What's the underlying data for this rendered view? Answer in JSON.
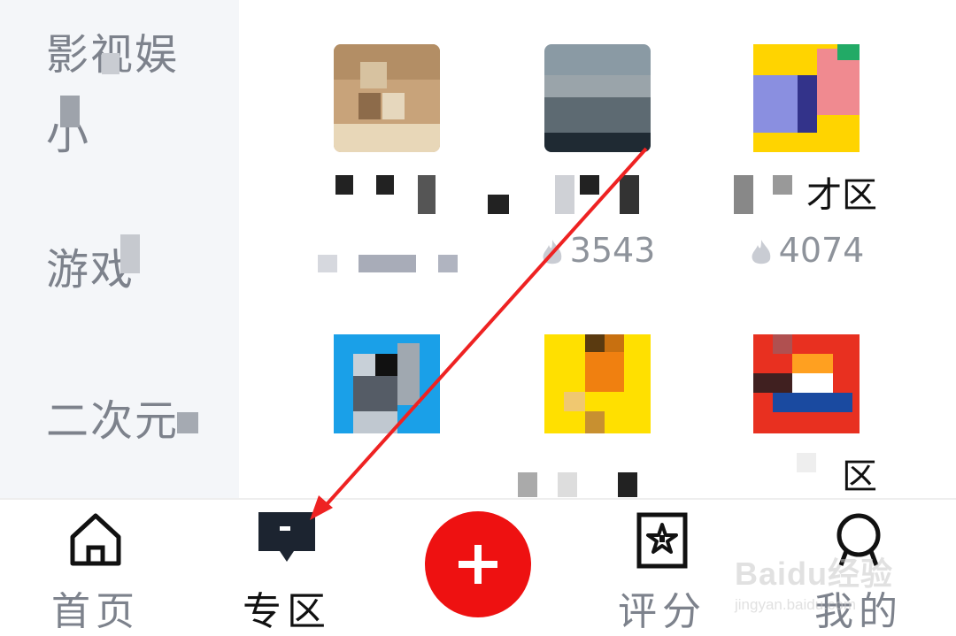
{
  "sidebar": {
    "items": [
      {
        "label": "影视娱"
      },
      {
        "label": "小"
      },
      {
        "label": "游戏"
      },
      {
        "label": "二次元"
      }
    ]
  },
  "zones": [
    {
      "name": "",
      "count": ""
    },
    {
      "name": "",
      "count": "3543"
    },
    {
      "name": "才区",
      "count": "4074"
    },
    {
      "name": "",
      "count": ""
    },
    {
      "name": "",
      "count": ""
    },
    {
      "name": "区",
      "count": ""
    }
  ],
  "tabbar": {
    "home": "首页",
    "zone": "专区",
    "rate": "评分",
    "mine": "我的"
  },
  "watermark": {
    "brand": "Baidu经验",
    "url": "jingyan.baidu.com"
  },
  "colors": {
    "accent_red": "#ee1111",
    "sidebar_bg": "#f4f6f9",
    "arrow": "#ee2222"
  }
}
